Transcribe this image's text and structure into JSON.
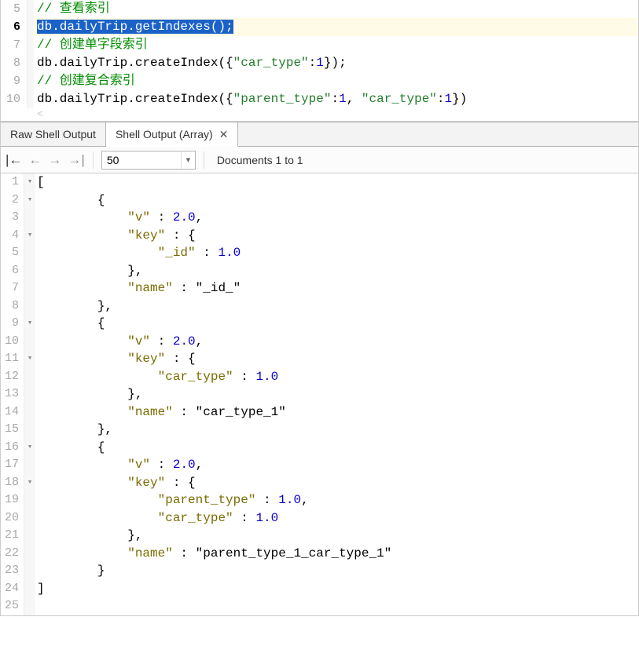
{
  "editor": {
    "lines": [
      {
        "n": "5",
        "type": "comment",
        "text": "// 查看索引"
      },
      {
        "n": "6",
        "type": "active",
        "raw": "db.dailyTrip.getIndexes();",
        "selected": "db.dailyTrip.getIndexes();"
      },
      {
        "n": "7",
        "type": "comment",
        "text": "// 创建单字段索引"
      },
      {
        "n": "8",
        "type": "code1",
        "prefix": "db.dailyTrip.createIndex({",
        "k1": "\"car_type\"",
        "v1": "1",
        "suffix": "});"
      },
      {
        "n": "9",
        "type": "comment",
        "text": "// 创建复合索引"
      },
      {
        "n": "10",
        "type": "code2",
        "prefix": "db.dailyTrip.createIndex({",
        "k1": "\"parent_type\"",
        "v1": "1",
        "k2": "\"car_type\"",
        "v2": "1",
        "suffix": "})"
      }
    ]
  },
  "tabs": {
    "raw": "Raw Shell Output",
    "array": "Shell Output (Array)"
  },
  "toolbar": {
    "pagesize": "50",
    "docinfo": "Documents 1 to 1"
  },
  "output": {
    "json_text": "[\n        {\n            \"v\" : 2.0,\n            \"key\" : {\n                \"_id\" : 1.0\n            },\n            \"name\" : \"_id_\"\n        },\n        {\n            \"v\" : 2.0,\n            \"key\" : {\n                \"car_type\" : 1.0\n            },\n            \"name\" : \"car_type_1\"\n        },\n        {\n            \"v\" : 2.0,\n            \"key\" : {\n                \"parent_type\" : 1.0,\n                \"car_type\" : 1.0\n            },\n            \"name\" : \"parent_type_1_car_type_1\"\n        }\n]",
    "lines": [
      {
        "n": "1",
        "fold": "▾",
        "t": "["
      },
      {
        "n": "2",
        "fold": "▾",
        "t": "        {"
      },
      {
        "n": "3",
        "fold": "",
        "t": "            \"v\" : 2.0,"
      },
      {
        "n": "4",
        "fold": "▾",
        "t": "            \"key\" : {"
      },
      {
        "n": "5",
        "fold": "",
        "t": "                \"_id\" : 1.0"
      },
      {
        "n": "6",
        "fold": "",
        "t": "            },"
      },
      {
        "n": "7",
        "fold": "",
        "t": "            \"name\" : \"_id_\""
      },
      {
        "n": "8",
        "fold": "",
        "t": "        },"
      },
      {
        "n": "9",
        "fold": "▾",
        "t": "        {"
      },
      {
        "n": "10",
        "fold": "",
        "t": "            \"v\" : 2.0,"
      },
      {
        "n": "11",
        "fold": "▾",
        "t": "            \"key\" : {"
      },
      {
        "n": "12",
        "fold": "",
        "t": "                \"car_type\" : 1.0"
      },
      {
        "n": "13",
        "fold": "",
        "t": "            },"
      },
      {
        "n": "14",
        "fold": "",
        "t": "            \"name\" : \"car_type_1\""
      },
      {
        "n": "15",
        "fold": "",
        "t": "        },"
      },
      {
        "n": "16",
        "fold": "▾",
        "t": "        {"
      },
      {
        "n": "17",
        "fold": "",
        "t": "            \"v\" : 2.0,"
      },
      {
        "n": "18",
        "fold": "▾",
        "t": "            \"key\" : {"
      },
      {
        "n": "19",
        "fold": "",
        "t": "                \"parent_type\" : 1.0,"
      },
      {
        "n": "20",
        "fold": "",
        "t": "                \"car_type\" : 1.0"
      },
      {
        "n": "21",
        "fold": "",
        "t": "            },"
      },
      {
        "n": "22",
        "fold": "",
        "t": "            \"name\" : \"parent_type_1_car_type_1\""
      },
      {
        "n": "23",
        "fold": "",
        "t": "        }"
      },
      {
        "n": "24",
        "fold": "",
        "t": "]"
      },
      {
        "n": "25",
        "fold": "",
        "t": ""
      }
    ]
  }
}
